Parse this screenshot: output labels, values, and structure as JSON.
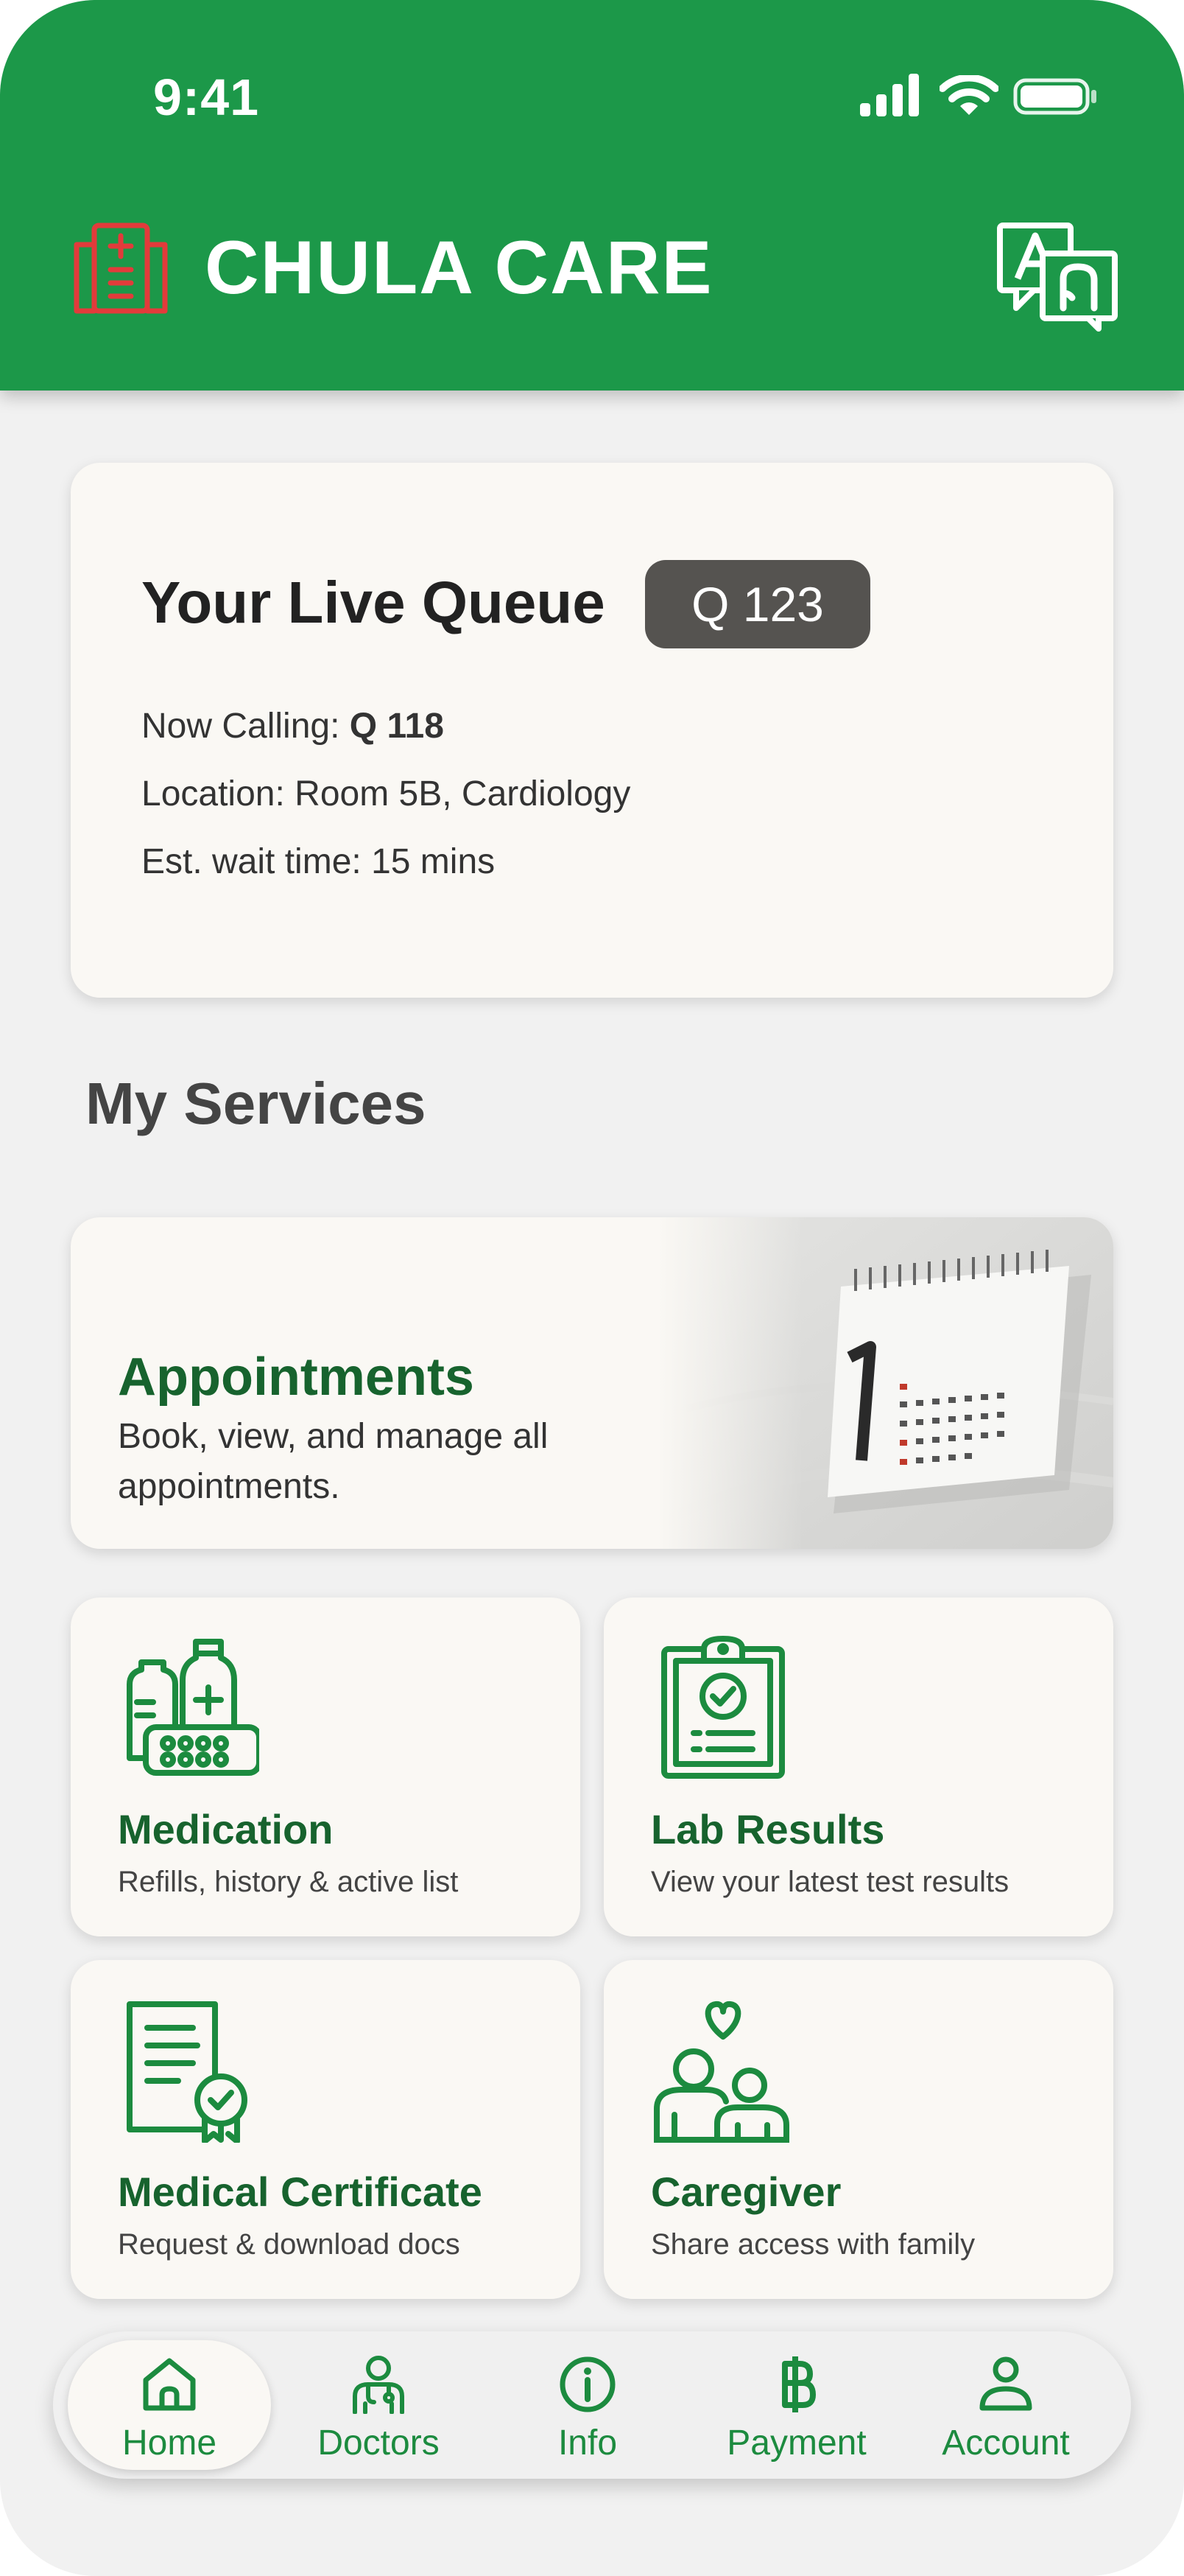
{
  "status_bar": {
    "time": "9:41"
  },
  "header": {
    "title": "CHULA CARE"
  },
  "queue": {
    "title": "Your Live Queue",
    "badge": "Q 123",
    "now_calling_label": "Now Calling:",
    "now_calling_value": "Q 118",
    "location": "Location: Room 5B, Cardiology",
    "wait_time": "Est. wait time: 15 mins"
  },
  "services": {
    "title": "My Services",
    "appointments": {
      "title": "Appointments",
      "description": "Book, view, and manage all appointments."
    },
    "tiles": [
      {
        "title": "Medication",
        "subtitle": "Refills, history & active list",
        "icon": "medication-icon"
      },
      {
        "title": "Lab Results",
        "subtitle": "View your latest test results",
        "icon": "clipboard-check-icon"
      },
      {
        "title": "Medical Certificate",
        "subtitle": "Request & download docs",
        "icon": "certificate-icon"
      },
      {
        "title": "Caregiver",
        "subtitle": "Share access with family",
        "icon": "family-heart-icon"
      }
    ]
  },
  "nav": {
    "items": [
      {
        "label": "Home",
        "icon": "home-icon",
        "active": true
      },
      {
        "label": "Doctors",
        "icon": "doctor-icon",
        "active": false
      },
      {
        "label": "Info",
        "icon": "info-icon",
        "active": false
      },
      {
        "label": "Payment",
        "icon": "baht-icon",
        "active": false
      },
      {
        "label": "Account",
        "icon": "user-icon",
        "active": false
      }
    ]
  },
  "colors": {
    "brand_green": "#1c9849",
    "dark_green_text": "#17632e",
    "card_background": "#faf8f4",
    "page_background": "#f1f1f1",
    "hospital_icon_red": "#e23b3b",
    "badge_background": "#555350"
  }
}
